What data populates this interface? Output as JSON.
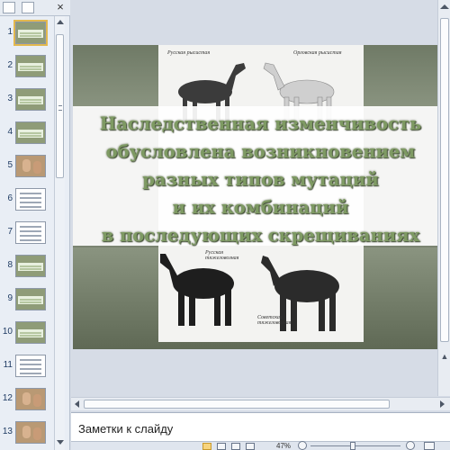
{
  "thumbnails": [
    {
      "num": "1",
      "selected": true,
      "kind": "horses"
    },
    {
      "num": "2",
      "selected": false,
      "kind": "text"
    },
    {
      "num": "3",
      "selected": false,
      "kind": "text"
    },
    {
      "num": "4",
      "selected": false,
      "kind": "text"
    },
    {
      "num": "5",
      "selected": false,
      "kind": "photo"
    },
    {
      "num": "6",
      "selected": false,
      "kind": "doc"
    },
    {
      "num": "7",
      "selected": false,
      "kind": "doc"
    },
    {
      "num": "8",
      "selected": false,
      "kind": "text"
    },
    {
      "num": "9",
      "selected": false,
      "kind": "text"
    },
    {
      "num": "10",
      "selected": false,
      "kind": "text"
    },
    {
      "num": "11",
      "selected": false,
      "kind": "doc"
    },
    {
      "num": "12",
      "selected": false,
      "kind": "photo"
    },
    {
      "num": "13",
      "selected": false,
      "kind": "photo"
    }
  ],
  "pane": {
    "close_label": "×"
  },
  "slide": {
    "captions": {
      "top_left": "Русская рысистая",
      "top_right": "Орловская рысистая",
      "bottom_left": "Русская тяжеловозная",
      "bottom_right": "Советская тяжеловозная"
    },
    "title_lines": [
      "Наследственная изменчивость",
      "обусловлена возникновением",
      "разных типов мутаций",
      "и их комбинаций",
      "в последующих скрещиваниях"
    ]
  },
  "notes": {
    "placeholder": "Заметки к слайду"
  },
  "status": {
    "zoom": "47%"
  },
  "colors": {
    "title": "#7e9a63",
    "slide_bg": "#7b8471",
    "selection": "#e2b84e"
  }
}
